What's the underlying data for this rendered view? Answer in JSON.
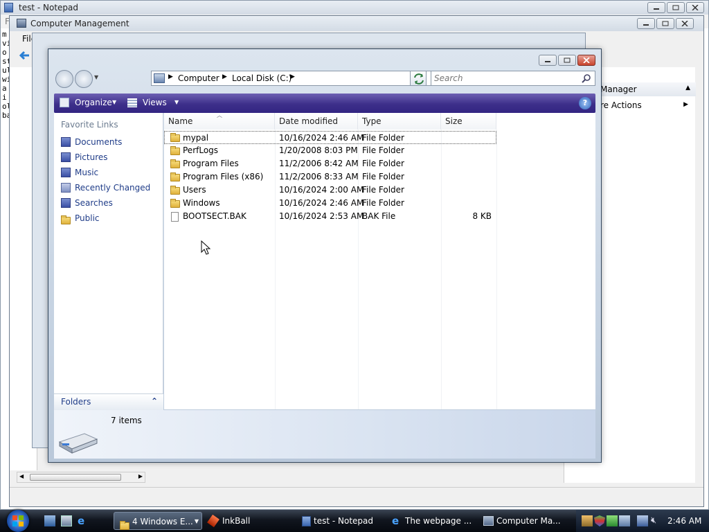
{
  "notepad": {
    "title": "test - Notepad",
    "menu_first": "F",
    "side_text": [
      "m",
      "vi",
      "o",
      "st",
      "ul",
      "wi",
      "a",
      "i",
      "ol",
      "ba"
    ]
  },
  "computer_management": {
    "title": "Computer Management",
    "menu_file": "File",
    "right_panel": {
      "header": "Manager",
      "item": "re Actions"
    },
    "left_fragments": [
      "F",
      "F"
    ]
  },
  "explorer": {
    "breadcrumb": [
      "Computer",
      "Local Disk (C:)"
    ],
    "search_placeholder": "Search",
    "toolbar": {
      "organize": "Organize",
      "views": "Views"
    },
    "favorite_links_header": "Favorite Links",
    "favorite_links": [
      {
        "label": "Documents",
        "icon": "documents-icon"
      },
      {
        "label": "Pictures",
        "icon": "pictures-icon"
      },
      {
        "label": "Music",
        "icon": "music-icon"
      },
      {
        "label": "Recently Changed",
        "icon": "recent-icon"
      },
      {
        "label": "Searches",
        "icon": "searches-icon"
      },
      {
        "label": "Public",
        "icon": "folder-icon"
      }
    ],
    "folders_label": "Folders",
    "columns": {
      "name": "Name",
      "date": "Date modified",
      "type": "Type",
      "size": "Size"
    },
    "files": [
      {
        "name": "mypal",
        "date": "10/16/2024 2:46 AM",
        "type": "File Folder",
        "size": "",
        "kind": "folder"
      },
      {
        "name": "PerfLogs",
        "date": "1/20/2008 8:03 PM",
        "type": "File Folder",
        "size": "",
        "kind": "folder"
      },
      {
        "name": "Program Files",
        "date": "11/2/2006 8:42 AM",
        "type": "File Folder",
        "size": "",
        "kind": "folder"
      },
      {
        "name": "Program Files (x86)",
        "date": "11/2/2006 8:33 AM",
        "type": "File Folder",
        "size": "",
        "kind": "folder"
      },
      {
        "name": "Users",
        "date": "10/16/2024 2:00 AM",
        "type": "File Folder",
        "size": "",
        "kind": "folder"
      },
      {
        "name": "Windows",
        "date": "10/16/2024 2:46 AM",
        "type": "File Folder",
        "size": "",
        "kind": "folder"
      },
      {
        "name": "BOOTSECT.BAK",
        "date": "10/16/2024 2:53 AM",
        "type": "BAK File",
        "size": "8 KB",
        "kind": "file"
      }
    ],
    "status": "7 items"
  },
  "taskbar": {
    "items": [
      {
        "label": "4 Windows E...",
        "icon": "folder-icon"
      },
      {
        "label": "InkBall",
        "icon": "inkball-icon"
      },
      {
        "label": "test - Notepad",
        "icon": "notepad-icon"
      },
      {
        "label": "The webpage ...",
        "icon": "ie-icon"
      },
      {
        "label": "Computer Ma...",
        "icon": "computer-management-icon"
      }
    ],
    "clock": "2:46 AM"
  }
}
